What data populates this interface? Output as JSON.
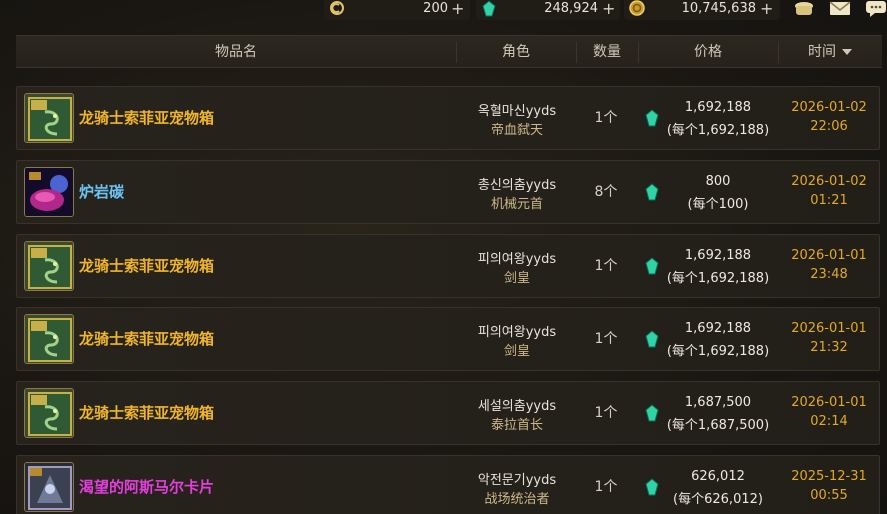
{
  "currency_bar": {
    "coin_value": "200",
    "gem_value": "248,924",
    "gold_value": "10,745,638",
    "plus_glyph": "+"
  },
  "table_header": {
    "item_name": "物品名",
    "role": "角色",
    "quantity": "数量",
    "price": "价格",
    "time": "时间"
  },
  "colors": {
    "epic_name": "#f0b52a",
    "rare_name": "#6cc3f2",
    "legendary_name": "#e43fdd",
    "time_text": "#e3a826",
    "gem_teal": "#2fd3a6"
  },
  "rows": [
    {
      "item_name": "龙骑士索菲亚宠物箱",
      "rarity": "epic",
      "icon": "pet-box-icon",
      "seller": "옥혈마신yyds",
      "seller_class": "帝血弑天",
      "quantity": "1个",
      "price_total": "1,692,188",
      "price_unit": "(每个1,692,188)",
      "date": "2026-01-02",
      "time": "22:06"
    },
    {
      "item_name": "炉岩碳",
      "rarity": "rare",
      "icon": "lava-carbon-icon",
      "seller": "총신의춤yyds",
      "seller_class": "机械元首",
      "quantity": "8个",
      "price_total": "800",
      "price_unit": "(每个100)",
      "date": "2026-01-02",
      "time": "01:21"
    },
    {
      "item_name": "龙骑士索菲亚宠物箱",
      "rarity": "epic",
      "icon": "pet-box-icon",
      "seller": "피의여왕yyds",
      "seller_class": "剑皇",
      "quantity": "1个",
      "price_total": "1,692,188",
      "price_unit": "(每个1,692,188)",
      "date": "2026-01-01",
      "time": "23:48"
    },
    {
      "item_name": "龙骑士索菲亚宠物箱",
      "rarity": "epic",
      "icon": "pet-box-icon",
      "seller": "피의여왕yyds",
      "seller_class": "剑皇",
      "quantity": "1个",
      "price_total": "1,692,188",
      "price_unit": "(每个1,692,188)",
      "date": "2026-01-01",
      "time": "21:32"
    },
    {
      "item_name": "龙骑士索菲亚宠物箱",
      "rarity": "epic",
      "icon": "pet-box-icon",
      "seller": "세설의춤yyds",
      "seller_class": "泰拉首长",
      "quantity": "1个",
      "price_total": "1,687,500",
      "price_unit": "(每个1,687,500)",
      "date": "2026-01-01",
      "time": "02:14"
    },
    {
      "item_name": "渴望的阿斯马尔卡片",
      "rarity": "legendary",
      "icon": "card-icon",
      "seller": "악전문기yyds",
      "seller_class": "战场统治者",
      "quantity": "1个",
      "price_total": "626,012",
      "price_unit": "(每个626,012)",
      "date": "2025-12-31",
      "time": "00:55"
    }
  ]
}
